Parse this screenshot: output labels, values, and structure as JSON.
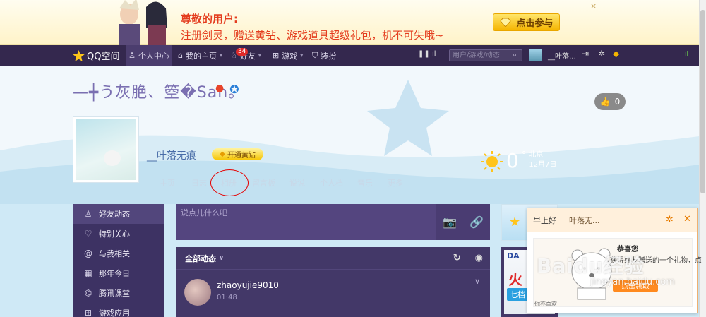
{
  "ad": {
    "title": "尊敬的用户:",
    "subtitle": "注册剑灵，赠送黄钻、游戏道具超级礼包，机不可失哦~",
    "cta": "点击参与",
    "close": "×"
  },
  "nav": {
    "logo": "QQ空间",
    "items": [
      {
        "label": "个人中心",
        "icon": "person-icon"
      },
      {
        "label": "我的主页",
        "icon": "home-icon"
      },
      {
        "label": "好友",
        "icon": "friends-icon"
      },
      {
        "label": "游戏",
        "icon": "grid-icon"
      },
      {
        "label": "装扮",
        "icon": "shirt-icon"
      }
    ],
    "friends_badge": "34",
    "search_placeholder": "用户/游戏/动态",
    "user_nick": "__叶落…"
  },
  "header": {
    "space_name": "—┿う灰脃、箜�San。",
    "like_count": "0",
    "profile_name": "__叶落无痕",
    "vip_label": "开通黄钻",
    "weather_temp": "0",
    "weather_unit": "°",
    "weather_city": "北京",
    "weather_date": "12月7日",
    "subnav": [
      "主页",
      "日志",
      "相册",
      "留言板",
      "说说",
      "个人档",
      "音乐",
      "更多"
    ]
  },
  "sidebar": {
    "items": [
      {
        "label": "好友动态",
        "icon": "person-icon"
      },
      {
        "label": "特别关心",
        "icon": "heart-icon"
      },
      {
        "label": "与我相关",
        "icon": "at-icon"
      },
      {
        "label": "那年今日",
        "icon": "calendar-icon"
      },
      {
        "label": "腾讯课堂",
        "icon": "graduation-icon"
      },
      {
        "label": "游戏应用",
        "icon": "apps-icon"
      }
    ]
  },
  "composer": {
    "placeholder": "说点儿什么吧"
  },
  "feed": {
    "filter_label": "全部动态",
    "post": {
      "user": "zhaoyujie9010",
      "time": "01:48"
    }
  },
  "popup": {
    "greeting": "早上好",
    "nick": "叶落无...",
    "congrats": "恭喜您",
    "gift_text": "获得好友赠送的一个礼物，点",
    "claim": "点击领取",
    "footer": "你亦喜欢"
  },
  "watermark": {
    "main": "Baidu经验",
    "sub": "jingyan.baidu.com"
  },
  "right": {
    "card_brand": "DA",
    "card_char": "火",
    "card_tag": "七档"
  }
}
